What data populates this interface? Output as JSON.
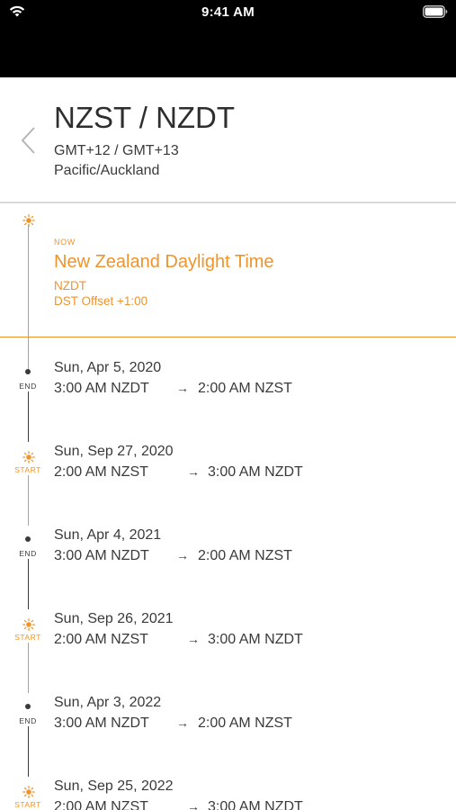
{
  "status_bar": {
    "time": "9:41 AM"
  },
  "header": {
    "title": "NZST / NZDT",
    "offsets": "GMT+12 / GMT+13",
    "zone": "Pacific/Auckland"
  },
  "current": {
    "label": "NOW",
    "name": "New Zealand Daylight Time",
    "abbr": "NZDT",
    "offset": "DST Offset +1:00"
  },
  "colors": {
    "accent": "#f0932a",
    "text": "#3a3a3a"
  },
  "transitions": [
    {
      "type": "END",
      "date": "Sun, Apr 5, 2020",
      "from": "3:00 AM NZDT",
      "arrow": "→",
      "to": "2:00 AM NZST"
    },
    {
      "type": "START",
      "date": "Sun, Sep 27, 2020",
      "from": "2:00 AM NZST",
      "arrow": "→",
      "to": "3:00 AM NZDT"
    },
    {
      "type": "END",
      "date": "Sun, Apr 4, 2021",
      "from": "3:00 AM NZDT",
      "arrow": "→",
      "to": "2:00 AM NZST"
    },
    {
      "type": "START",
      "date": "Sun, Sep 26, 2021",
      "from": "2:00 AM NZST",
      "arrow": "→",
      "to": "3:00 AM NZDT"
    },
    {
      "type": "END",
      "date": "Sun, Apr 3, 2022",
      "from": "3:00 AM NZDT",
      "arrow": "→",
      "to": "2:00 AM NZST"
    },
    {
      "type": "START",
      "date": "Sun, Sep 25, 2022",
      "from": "2:00 AM NZST",
      "arrow": "→",
      "to": "3:00 AM NZDT"
    }
  ]
}
